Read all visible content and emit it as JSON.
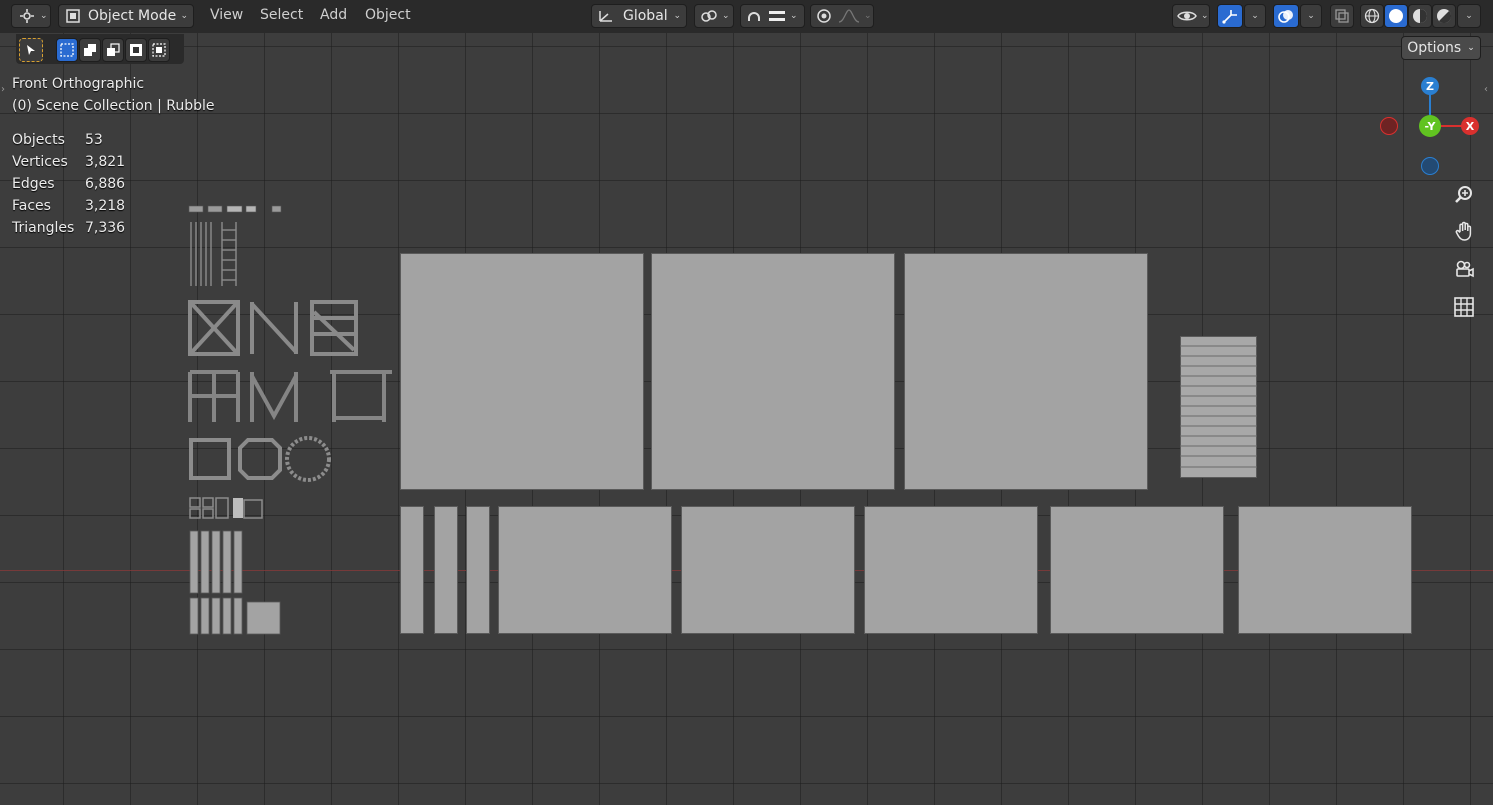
{
  "header": {
    "mode_label": "Object Mode",
    "menu": [
      "View",
      "Select",
      "Add",
      "Object"
    ],
    "transform_orientation": "Global",
    "options_label": "Options"
  },
  "overlay": {
    "view_name": "Front Orthographic",
    "collection": "(0) Scene Collection | Rubble"
  },
  "stats": [
    {
      "label": "Objects",
      "value": "53"
    },
    {
      "label": "Vertices",
      "value": "3,821"
    },
    {
      "label": "Edges",
      "value": "6,886"
    },
    {
      "label": "Faces",
      "value": "3,218"
    },
    {
      "label": "Triangles",
      "value": "7,336"
    }
  ],
  "gizmo": {
    "z": "Z",
    "y": "-Y",
    "x": "X"
  },
  "colors": {
    "x_axis": "#d9302e",
    "y_axis": "#61c321",
    "z_axis": "#2a7fd1",
    "active": "#2a6bd1"
  },
  "icons": [
    "editor-type-icon",
    "object-mode-icon",
    "orientation-icon",
    "pivot-icon",
    "snap-icon",
    "proportional-edit-icon",
    "visibility-icon",
    "gizmo-icon",
    "overlay-icon",
    "xray-icon",
    "wireframe-shading-icon",
    "solid-shading-icon",
    "material-shading-icon",
    "rendered-shading-icon",
    "zoom-icon",
    "pan-hand-icon",
    "camera-icon",
    "ortho-grid-icon"
  ]
}
